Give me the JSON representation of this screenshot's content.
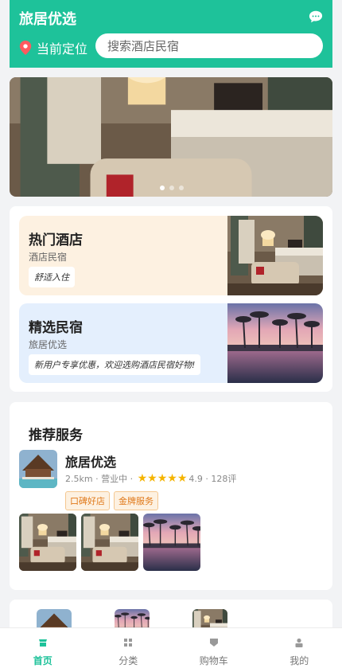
{
  "header": {
    "title": "旅居优选",
    "location_label": "当前定位",
    "search_placeholder": "搜索酒店民宿"
  },
  "banner": {
    "slides_count": 3,
    "active_index": 0
  },
  "categories": [
    {
      "title": "热门酒店",
      "subtitle": "酒店民宿",
      "tag": "舒适入住"
    },
    {
      "title": "精选民宿",
      "subtitle": "旅居优选",
      "tag": "新用户专享优惠，欢迎选购酒店民宿好物!"
    }
  ],
  "recommend": {
    "section_title": "推荐服务",
    "shop": {
      "name": "旅居优选",
      "distance": "2.5km",
      "status": "营业中",
      "rating": "4.9",
      "reviews": "128评",
      "stars": 5,
      "tags": [
        "口碑好店",
        "金牌服务"
      ]
    }
  },
  "tabs": [
    {
      "label": "首页",
      "icon": "home-icon",
      "active": true
    },
    {
      "label": "分类",
      "icon": "grid-icon",
      "active": false
    },
    {
      "label": "购物车",
      "icon": "cart-icon",
      "active": false
    },
    {
      "label": "我的",
      "icon": "user-icon",
      "active": false
    }
  ],
  "colors": {
    "brand": "#1ec29a",
    "star": "#f5b400",
    "tag_text": "#e0791a"
  }
}
